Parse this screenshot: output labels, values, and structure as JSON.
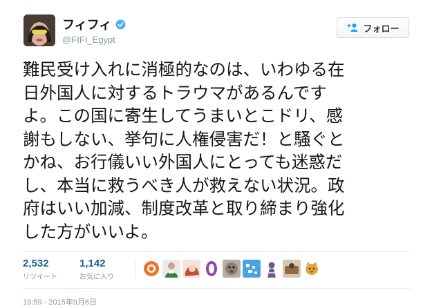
{
  "profile": {
    "display_name": "フィフィ",
    "handle": "@FIFI_Egypt",
    "avatar_icon": "user-avatar",
    "verified_icon": "verified-badge-icon",
    "verified_color": "#55acee"
  },
  "actions": {
    "follow_label": "フォロー",
    "follow_icon": "add-user-icon"
  },
  "tweet": {
    "lines": [
      "難民受け入れに消極的なのは、いわゆる在",
      "日外国人に対するトラウマがあるんです",
      "よ。この国に寄生してうまいとこドリ、感",
      "謝もしない、挙句に人権侵害だ！と騒ぐと",
      "かね、お行儀いい外国人にとっても迷惑だ",
      "し、本当に救うべき人が救えない状況。政",
      "府はいい加減、制度改革と取り締まり強化",
      "した方がいいよ。"
    ]
  },
  "stats": {
    "retweets_count": "2,532",
    "retweets_label": "リツイート",
    "favorites_count": "1,142",
    "favorites_label": "お気に入り"
  },
  "favoriters": {
    "avatar_colors": [
      "#e8742a",
      "#3c7d3c",
      "#c0503a",
      "#8e44ad",
      "#8a7f72",
      "#4aa3df",
      "#6b5a8a",
      "#d8c7a8",
      "#e0a53a"
    ]
  },
  "timestamp": "19:59 - 2015年9月6日",
  "colors": {
    "link": "#1d5f90",
    "muted": "#8899a6",
    "text": "#14171a"
  }
}
